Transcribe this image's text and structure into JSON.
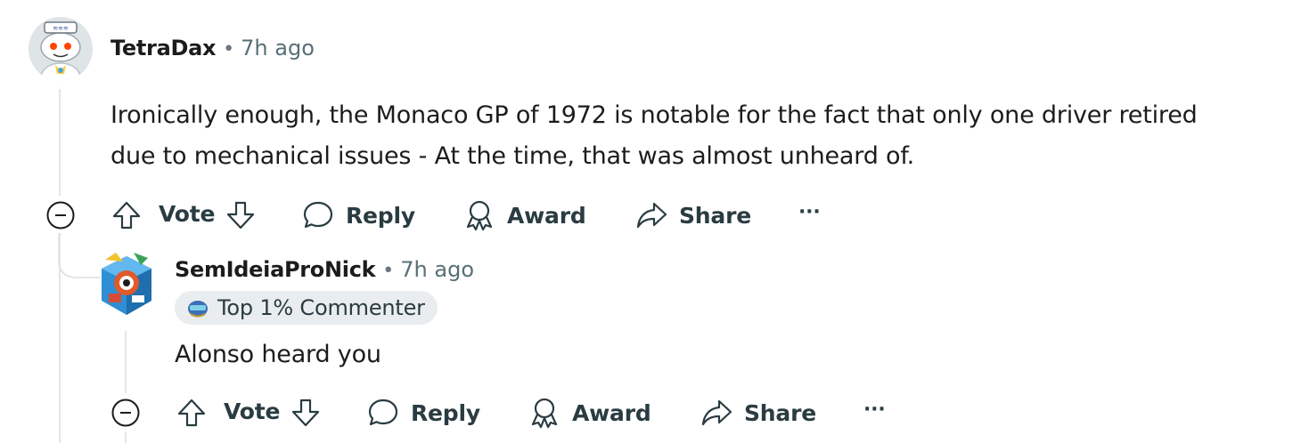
{
  "comment": {
    "username": "TetraDax",
    "separator": "•",
    "time": "7h ago",
    "body_line_1": "Ironically enough, the Monaco GP of 1972 is notable for the fact that only one driver retired",
    "body_line_2": "due to mechanical issues - At the time, that was almost unheard of.",
    "actions": {
      "vote": "Vote",
      "reply": "Reply",
      "award": "Award",
      "share": "Share",
      "more": "···"
    }
  },
  "reply": {
    "username": "SemIdeiaProNick",
    "separator": "•",
    "time": "7h ago",
    "badge": "Top 1% Commenter",
    "body": "Alonso heard you",
    "actions": {
      "vote": "Vote",
      "reply": "Reply",
      "award": "Award",
      "share": "Share",
      "more": "···"
    }
  },
  "colors": {
    "text": "#1c1c1c",
    "meta": "#576f76",
    "action": "#2a3c42",
    "thread_line": "#e2e6e8",
    "badge_bg": "#eaedef"
  }
}
